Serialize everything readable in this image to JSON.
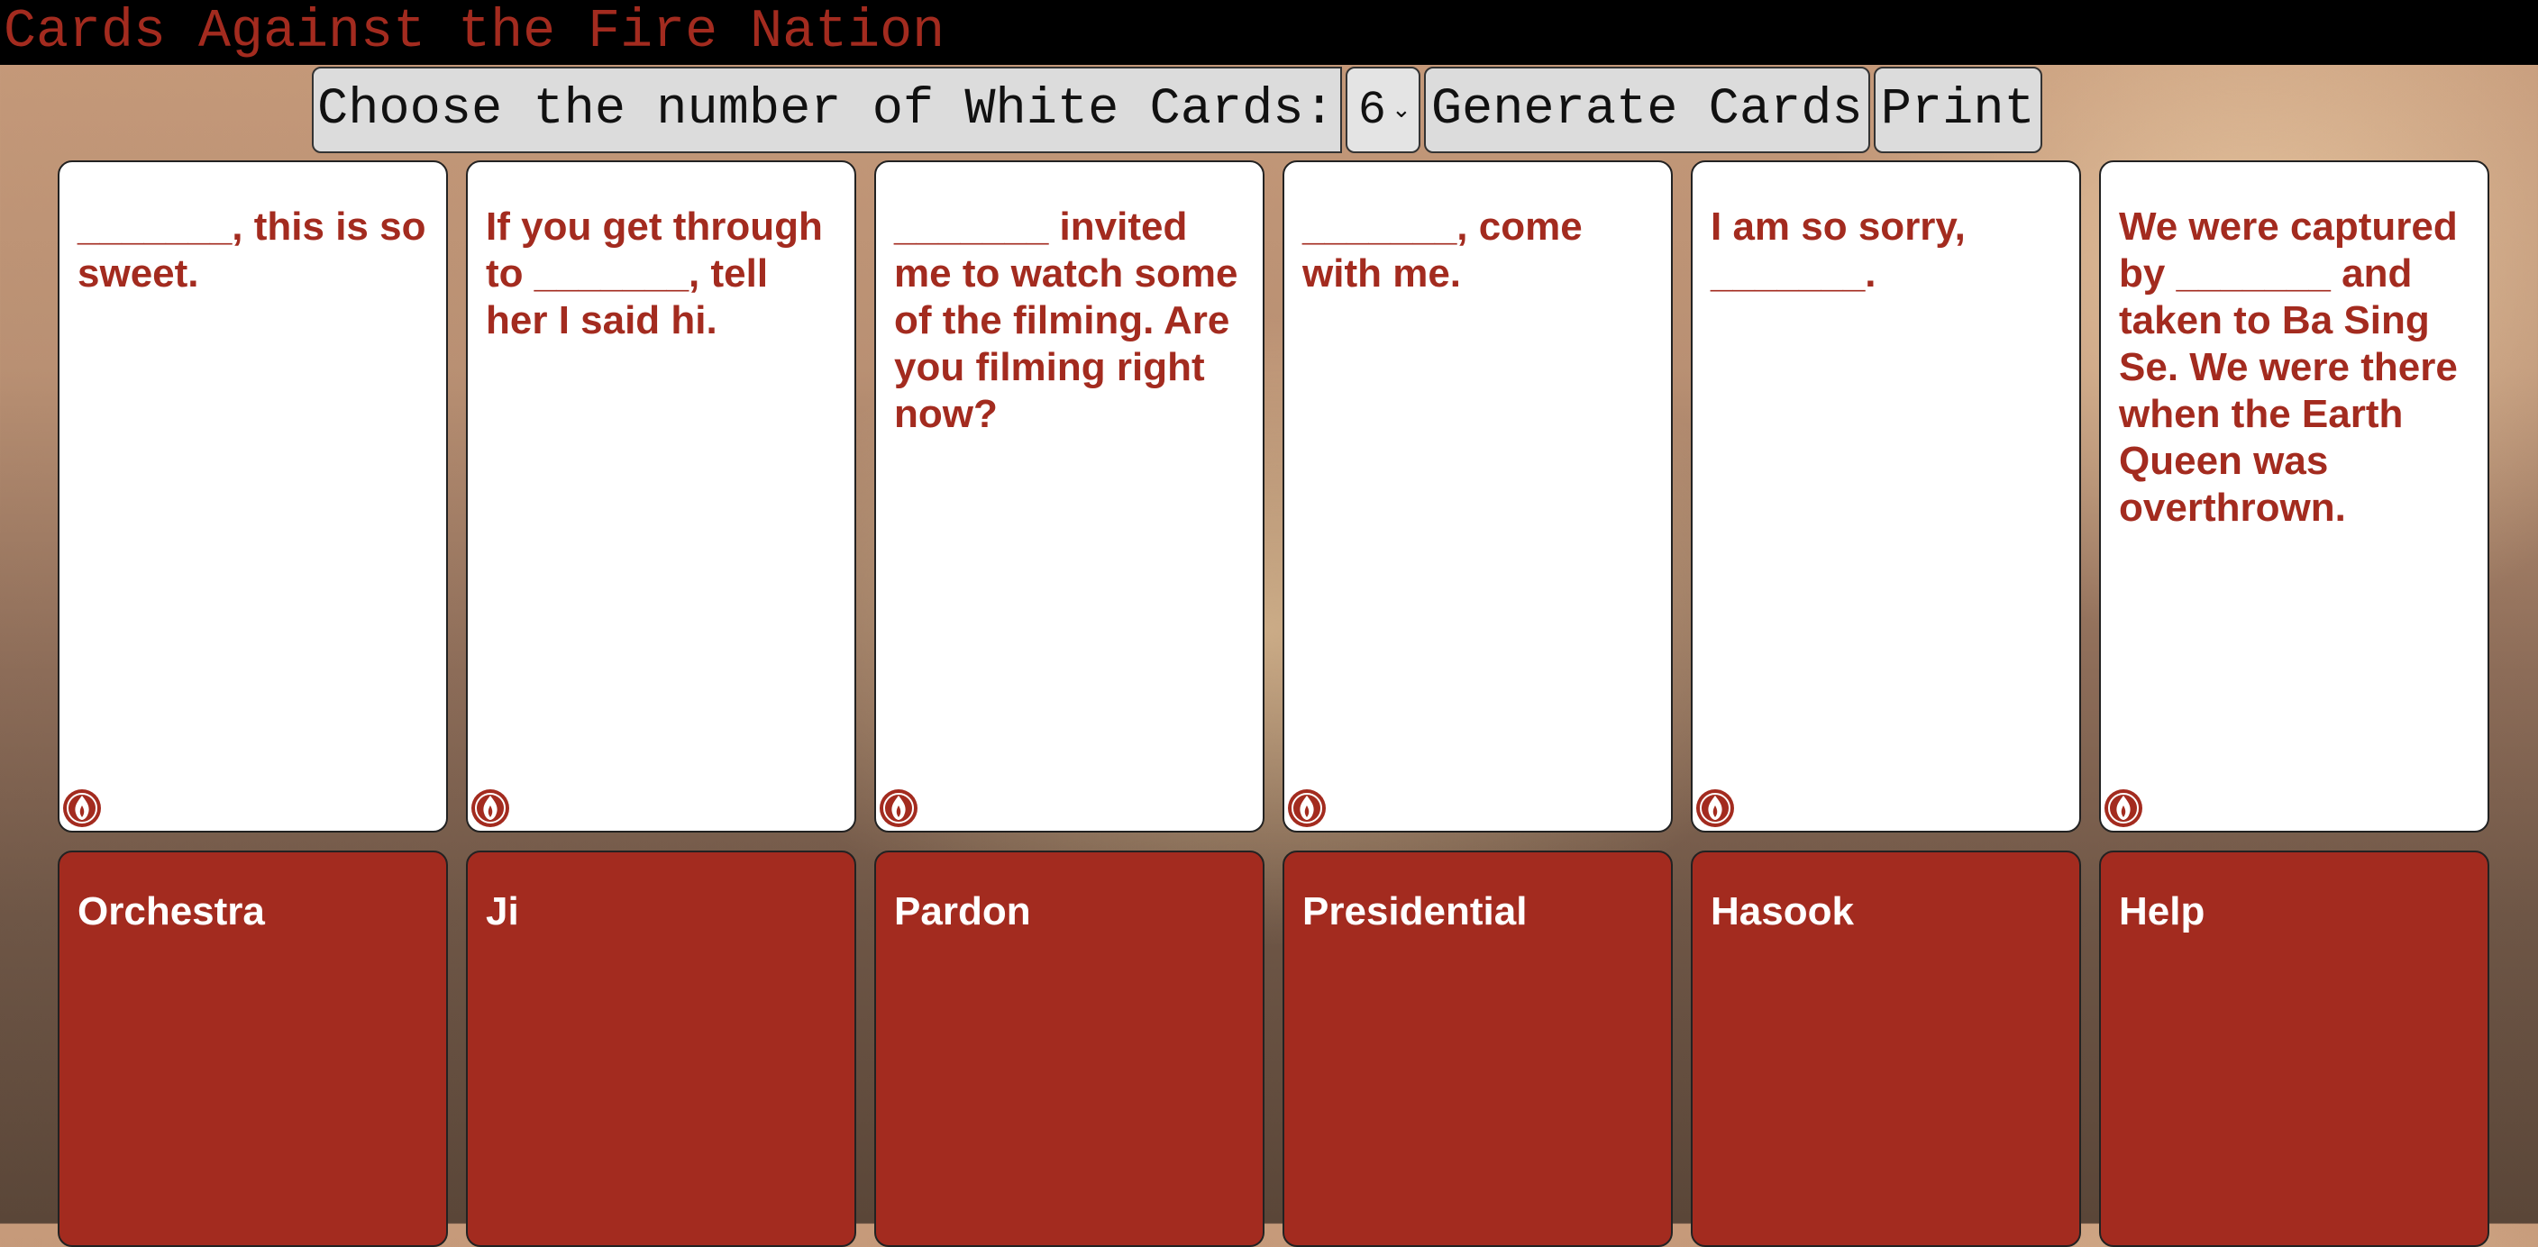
{
  "app": {
    "title": "Cards Against the Fire Nation"
  },
  "controls": {
    "label": "Choose the number of White Cards:",
    "count_value": "6",
    "generate_label": "Generate Cards",
    "print_label": "Print"
  },
  "white_cards": [
    {
      "text": "_______, this is so sweet."
    },
    {
      "text": "If you get through to _______, tell her I said hi."
    },
    {
      "text": "_______ invited me to watch some of the filming. Are you filming right now?"
    },
    {
      "text": "_______, come with me."
    },
    {
      "text": "I am so sorry, _______."
    },
    {
      "text": "We were captured by _______ and taken to Ba Sing Se. We were there when the Earth Queen was overthrown."
    }
  ],
  "black_cards": [
    {
      "text": "Orchestra"
    },
    {
      "text": "Ji"
    },
    {
      "text": "Pardon"
    },
    {
      "text": "Presidential"
    },
    {
      "text": "Hasook"
    },
    {
      "text": "Help"
    }
  ],
  "icons": {
    "card_corner": "fire-nation-emblem-icon"
  },
  "colors": {
    "accent": "#a32b1f",
    "topbar": "#000000",
    "control_bg": "#dcdcdc"
  }
}
